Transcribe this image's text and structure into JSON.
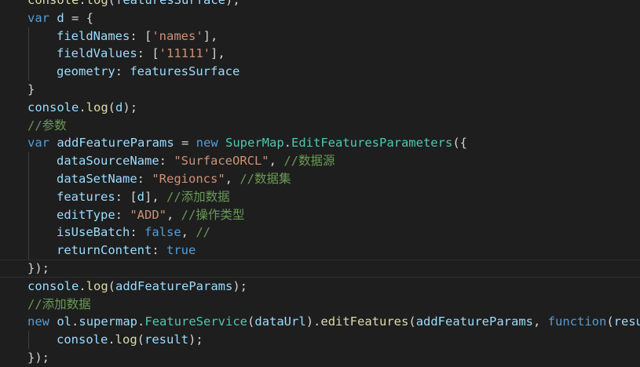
{
  "editor": {
    "theme": {
      "background": "#1e1e1e",
      "keyword": "#569cd6",
      "variable": "#9cdcfe",
      "function": "#dcdcaa",
      "class": "#4ec9b0",
      "string": "#ce9178",
      "comment": "#6a9955",
      "text": "#d4d4d4"
    },
    "lines": [
      {
        "indent": 0,
        "tokens": [
          {
            "t": "fn",
            "v": "console"
          },
          {
            "t": "pun",
            "v": "."
          },
          {
            "t": "fn",
            "v": "log"
          },
          {
            "t": "pun",
            "v": "("
          },
          {
            "t": "var",
            "v": "featuresSurface"
          },
          {
            "t": "pun",
            "v": ");"
          }
        ]
      },
      {
        "indent": 0,
        "tokens": [
          {
            "t": "kw",
            "v": "var"
          },
          {
            "t": "pun",
            "v": " "
          },
          {
            "t": "var",
            "v": "d"
          },
          {
            "t": "pun",
            "v": " = {"
          }
        ]
      },
      {
        "indent": 1,
        "tokens": [
          {
            "t": "var",
            "v": "fieldNames"
          },
          {
            "t": "pun",
            "v": ": ["
          },
          {
            "t": "str",
            "v": "'names'"
          },
          {
            "t": "pun",
            "v": "],"
          }
        ]
      },
      {
        "indent": 1,
        "tokens": [
          {
            "t": "var",
            "v": "fieldValues"
          },
          {
            "t": "pun",
            "v": ": ["
          },
          {
            "t": "str",
            "v": "'11111'"
          },
          {
            "t": "pun",
            "v": "],"
          }
        ]
      },
      {
        "indent": 1,
        "tokens": [
          {
            "t": "var",
            "v": "geometry"
          },
          {
            "t": "pun",
            "v": ": "
          },
          {
            "t": "var",
            "v": "featuresSurface"
          }
        ]
      },
      {
        "indent": 0,
        "tokens": [
          {
            "t": "pun",
            "v": "}"
          }
        ]
      },
      {
        "indent": 0,
        "tokens": [
          {
            "t": "var",
            "v": "console"
          },
          {
            "t": "pun",
            "v": "."
          },
          {
            "t": "fn",
            "v": "log"
          },
          {
            "t": "pun",
            "v": "("
          },
          {
            "t": "var",
            "v": "d"
          },
          {
            "t": "pun",
            "v": ");"
          }
        ]
      },
      {
        "indent": 0,
        "tokens": [
          {
            "t": "com",
            "v": "//参数"
          }
        ]
      },
      {
        "indent": 0,
        "tokens": [
          {
            "t": "kw",
            "v": "var"
          },
          {
            "t": "pun",
            "v": " "
          },
          {
            "t": "var",
            "v": "addFeatureParams"
          },
          {
            "t": "pun",
            "v": " = "
          },
          {
            "t": "kw",
            "v": "new"
          },
          {
            "t": "pun",
            "v": " "
          },
          {
            "t": "cls",
            "v": "SuperMap"
          },
          {
            "t": "pun",
            "v": "."
          },
          {
            "t": "cls",
            "v": "EditFeaturesParameters"
          },
          {
            "t": "pun",
            "v": "({"
          }
        ]
      },
      {
        "indent": 1,
        "tokens": [
          {
            "t": "var",
            "v": "dataSourceName"
          },
          {
            "t": "pun",
            "v": ": "
          },
          {
            "t": "str",
            "v": "\"SurfaceORCL\""
          },
          {
            "t": "pun",
            "v": ", "
          },
          {
            "t": "com",
            "v": "//数据源"
          }
        ]
      },
      {
        "indent": 1,
        "tokens": [
          {
            "t": "var",
            "v": "dataSetName"
          },
          {
            "t": "pun",
            "v": ": "
          },
          {
            "t": "str",
            "v": "\"Regioncs\""
          },
          {
            "t": "pun",
            "v": ", "
          },
          {
            "t": "com",
            "v": "//数据集"
          }
        ]
      },
      {
        "indent": 1,
        "tokens": [
          {
            "t": "var",
            "v": "features"
          },
          {
            "t": "pun",
            "v": ": ["
          },
          {
            "t": "var",
            "v": "d"
          },
          {
            "t": "pun",
            "v": "], "
          },
          {
            "t": "com",
            "v": "//添加数据"
          }
        ]
      },
      {
        "indent": 1,
        "tokens": [
          {
            "t": "var",
            "v": "editType"
          },
          {
            "t": "pun",
            "v": ": "
          },
          {
            "t": "str",
            "v": "\"ADD\""
          },
          {
            "t": "pun",
            "v": ", "
          },
          {
            "t": "com",
            "v": "//操作类型"
          }
        ]
      },
      {
        "indent": 1,
        "tokens": [
          {
            "t": "var",
            "v": "isUseBatch"
          },
          {
            "t": "pun",
            "v": ": "
          },
          {
            "t": "kw",
            "v": "false"
          },
          {
            "t": "pun",
            "v": ", "
          },
          {
            "t": "com",
            "v": "//"
          }
        ]
      },
      {
        "indent": 1,
        "tokens": [
          {
            "t": "var",
            "v": "returnContent"
          },
          {
            "t": "pun",
            "v": ": "
          },
          {
            "t": "kw",
            "v": "true"
          }
        ]
      },
      {
        "indent": 0,
        "current": true,
        "tokens": [
          {
            "t": "pun",
            "v": "});"
          }
        ]
      },
      {
        "indent": 0,
        "tokens": [
          {
            "t": "var",
            "v": "console"
          },
          {
            "t": "pun",
            "v": "."
          },
          {
            "t": "fn",
            "v": "log"
          },
          {
            "t": "pun",
            "v": "("
          },
          {
            "t": "var",
            "v": "addFeatureParams"
          },
          {
            "t": "pun",
            "v": ");"
          }
        ]
      },
      {
        "indent": 0,
        "tokens": [
          {
            "t": "com",
            "v": "//添加数据"
          }
        ]
      },
      {
        "indent": 0,
        "tokens": [
          {
            "t": "kw",
            "v": "new"
          },
          {
            "t": "pun",
            "v": " "
          },
          {
            "t": "var",
            "v": "ol"
          },
          {
            "t": "pun",
            "v": "."
          },
          {
            "t": "var",
            "v": "supermap"
          },
          {
            "t": "pun",
            "v": "."
          },
          {
            "t": "cls",
            "v": "FeatureService"
          },
          {
            "t": "pun",
            "v": "("
          },
          {
            "t": "var",
            "v": "dataUrl"
          },
          {
            "t": "pun",
            "v": ")."
          },
          {
            "t": "fn",
            "v": "editFeatures"
          },
          {
            "t": "pun",
            "v": "("
          },
          {
            "t": "var",
            "v": "addFeatureParams"
          },
          {
            "t": "pun",
            "v": ", "
          },
          {
            "t": "kw",
            "v": "function"
          },
          {
            "t": "pun",
            "v": "("
          },
          {
            "t": "var",
            "v": "resul"
          }
        ]
      },
      {
        "indent": 1,
        "tokens": [
          {
            "t": "var",
            "v": "console"
          },
          {
            "t": "pun",
            "v": "."
          },
          {
            "t": "fn",
            "v": "log"
          },
          {
            "t": "pun",
            "v": "("
          },
          {
            "t": "var",
            "v": "result"
          },
          {
            "t": "pun",
            "v": ");"
          }
        ]
      },
      {
        "indent": 0,
        "tokens": [
          {
            "t": "pun",
            "v": "});"
          }
        ]
      }
    ]
  }
}
